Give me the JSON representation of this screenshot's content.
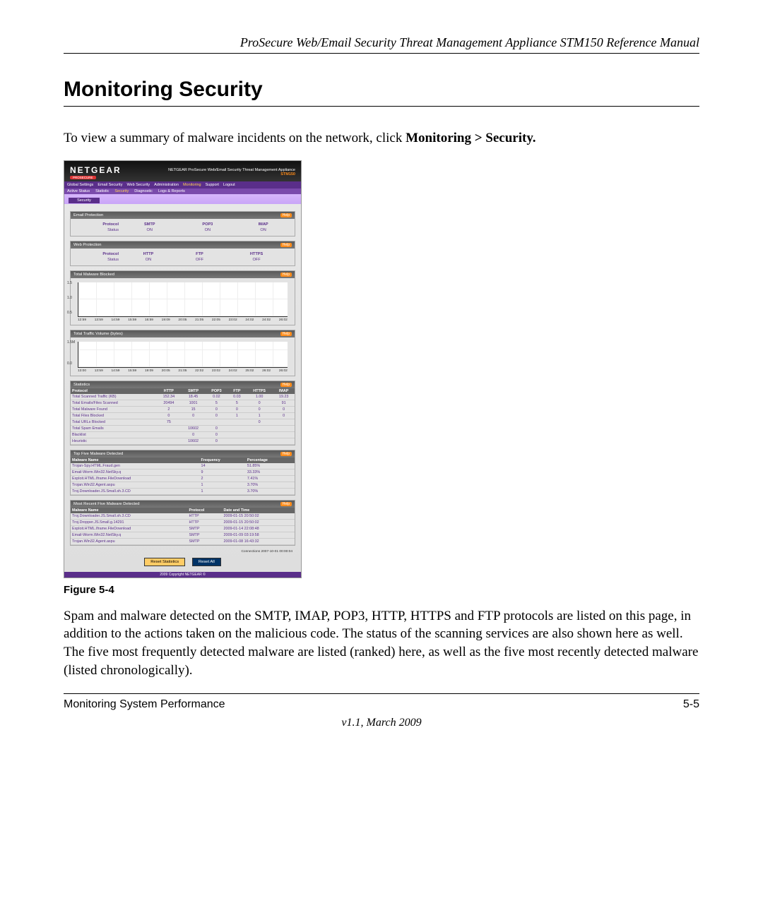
{
  "doc": {
    "header": "ProSecure Web/Email Security Threat Management Appliance STM150 Reference Manual",
    "h1": "Monitoring Security",
    "intro_a": "To view a summary of malware incidents on the network, click ",
    "intro_bold": "Monitoring > Security.",
    "figure_label": "Figure 5-4",
    "para2": "Spam and malware detected on the SMTP, IMAP, POP3, HTTP, HTTPS and FTP protocols are listed on this page, in addition to the actions taken on the malicious code. The status of the scanning services are also shown here as well. The five most frequently detected malware are listed (ranked) here, as well as the five most recently detected malware (listed chronologically).",
    "footer_left": "Monitoring System Performance",
    "footer_right": "5-5",
    "footer_ver": "v1.1, March 2009"
  },
  "mini": {
    "logo": "NETGEAR",
    "logo_sub": "PROSECURE",
    "head_right1": "NETGEAR ProSecure Web/Email Security Threat Management Appliance",
    "head_right2": "STM150",
    "menu": [
      "Global Settings",
      "Email Security",
      "Web Security",
      "Administration",
      "Monitoring",
      "Support",
      "Logout"
    ],
    "submenu_pre": [
      "Active Status",
      "Statistic"
    ],
    "submenu_mid": "Security",
    "submenu_post": [
      "Diagnostic",
      "Logs & Reports"
    ],
    "tab": "Security",
    "email": {
      "title": "Email Protection",
      "help": "Help",
      "row_label": "Protocol",
      "cols": [
        "SMTP",
        "POP3",
        "IMAP"
      ],
      "status_label": "Status",
      "status": [
        "ON",
        "ON",
        "ON"
      ]
    },
    "web": {
      "title": "Web Protection",
      "help": "Help",
      "row_label": "Protocol",
      "cols": [
        "HTTP",
        "FTP",
        "HTTPS"
      ],
      "status_label": "Status",
      "status": [
        "ON",
        "OFF",
        "OFF"
      ]
    },
    "chart1": {
      "title": "Total Malware Blocked",
      "help": "Help",
      "y": [
        "1.5",
        "1.0",
        "0.5"
      ],
      "x": [
        "12:59",
        "13:59",
        "14:59",
        "15:59",
        "16:59",
        "19:09",
        "20:05",
        "21:05",
        "22:05",
        "23:02",
        "24:02",
        "24:02",
        "26:02"
      ]
    },
    "chart2": {
      "title": "Total Traffic Volume (bytes)",
      "help": "Help",
      "y": [
        "1.5M",
        "0.0"
      ],
      "x": [
        "13:00",
        "13:59",
        "14:59",
        "15:59",
        "19:09",
        "20:05",
        "21:05",
        "22:02",
        "23:02",
        "24:02",
        "25:02",
        "26:02",
        "26:02"
      ]
    },
    "stats": {
      "title": "Statistics",
      "help": "Help",
      "headers": [
        "Protocol",
        "HTTP",
        "SMTP",
        "POP3",
        "FTP",
        "HTTPS",
        "IMAP"
      ],
      "rows": [
        [
          "Total Scanned Traffic (KB)",
          "152.34",
          "18.45",
          "0.02",
          "0.03",
          "1.00",
          "19.23"
        ],
        [
          "Total Emails/Files Scanned",
          "20494",
          "1001",
          "5",
          "5",
          "0",
          "91"
        ],
        [
          "Total Malware Found",
          "2",
          "15",
          "0",
          "0",
          "0",
          "0"
        ],
        [
          "Total Files Blocked",
          "0",
          "0",
          "0",
          "1",
          "1",
          "0"
        ],
        [
          "Total URLs Blocked",
          "75",
          "",
          "",
          "",
          "0",
          ""
        ],
        [
          "Total Spam Emails",
          "",
          "10602",
          "0",
          "",
          "",
          ""
        ],
        [
          "Blacklist",
          "",
          "0",
          "0",
          "",
          "",
          ""
        ],
        [
          "Heuristic",
          "",
          "10602",
          "0",
          "",
          "",
          ""
        ]
      ]
    },
    "top5": {
      "title": "Top Five Malware Detected",
      "help": "Help",
      "headers": [
        "Malware Name",
        "Frequency",
        "Percentage"
      ],
      "rows": [
        [
          "Trojan-Spy.HTML.Fraud.gen",
          "14",
          "51.85%"
        ],
        [
          "Email-Worm.Win32.NetSky.q",
          "9",
          "33.33%"
        ],
        [
          "Exploit.HTML.Iframe.FileDownload",
          "2",
          "7.41%"
        ],
        [
          "Trojan.Win32.Agent.aspu",
          "1",
          "3.70%"
        ],
        [
          "Troj.Downloader.JS.Small.sh.3.CD",
          "1",
          "3.70%"
        ]
      ]
    },
    "recent5": {
      "title": "Most Recent Five Malware Detected",
      "help": "Help",
      "headers": [
        "Malware Name",
        "Protocol",
        "Date and Time"
      ],
      "rows": [
        [
          "Troj.Downloader.JS.Small.sh.3.CD",
          "HTTP",
          "2009-01-15 20:50:02"
        ],
        [
          "Troj.Dropper.JS.Small.g.14291",
          "HTTP",
          "2009-01-15 20:50:02"
        ],
        [
          "Exploit.HTML.Iframe.FileDownload",
          "SMTP",
          "2009-01-14 22:08:48"
        ],
        [
          "Email-Worm.Win32.NetSky.q",
          "SMTP",
          "2009-01-09 03:19:58"
        ],
        [
          "Trojan.Win32.Agent.aspu",
          "SMTP",
          "2009-01-08 16:43:32"
        ]
      ]
    },
    "counter": "Connections 2007-10-01 00:00:04",
    "btn_reset_stats": "Reset Statistics",
    "btn_reset_all": "Reset All",
    "copyright": "2009 Copyright NETGEAR ©"
  }
}
